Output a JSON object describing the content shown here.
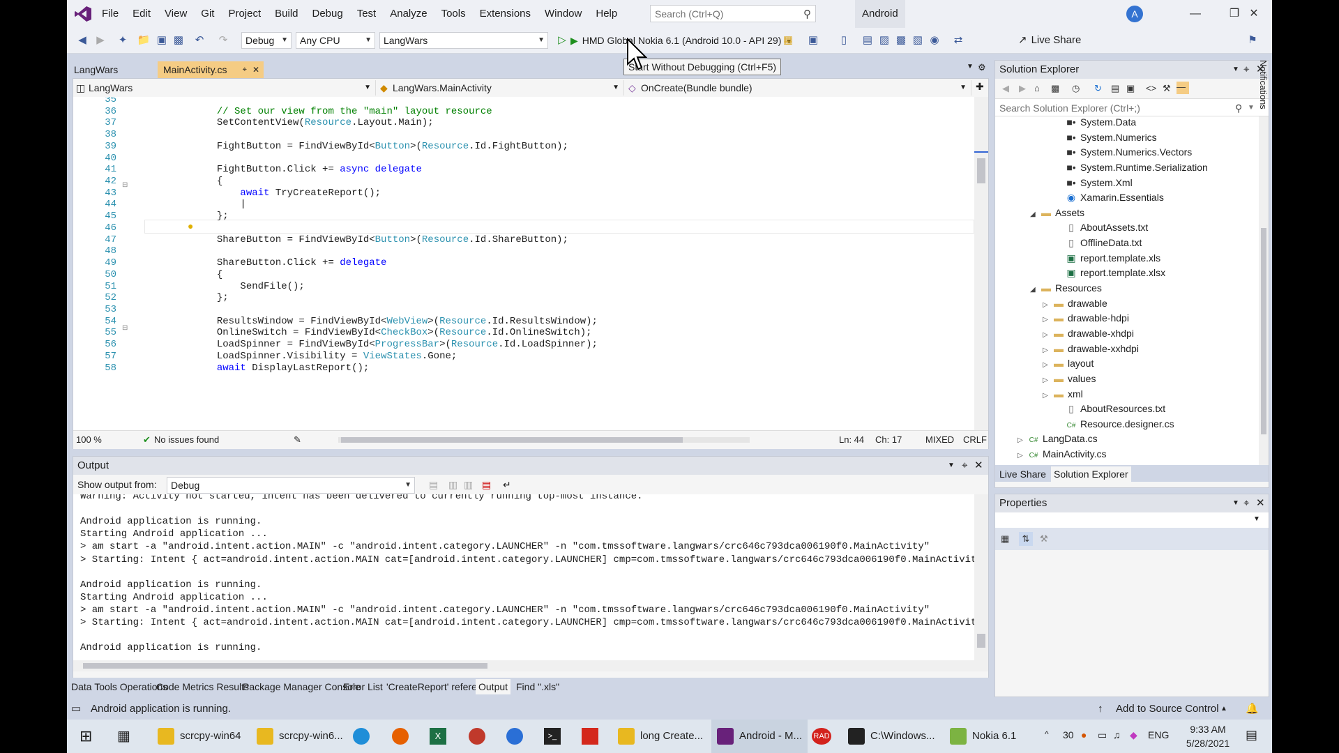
{
  "menu": [
    "File",
    "Edit",
    "View",
    "Git",
    "Project",
    "Build",
    "Debug",
    "Test",
    "Analyze",
    "Tools",
    "Extensions",
    "Window",
    "Help"
  ],
  "search": {
    "placeholder": "Search (Ctrl+Q)"
  },
  "solution_name": "Android",
  "user_initial": "A",
  "toolbar": {
    "config": "Debug",
    "platform": "Any CPU",
    "startup_project": "LangWars",
    "device": "HMD Global Nokia 6.1 (Android 10.0 - API 29)",
    "live_share": "Live Share"
  },
  "tooltip": "Start Without Debugging (Ctrl+F5)",
  "doc_tabs": [
    {
      "label": "LangWars"
    },
    {
      "label": "MainActivity.cs"
    }
  ],
  "nav": {
    "project": "LangWars",
    "type": "LangWars.MainActivity",
    "member": "OnCreate(Bundle bundle)"
  },
  "code_lines": [
    {
      "n": "35",
      "t": ""
    },
    {
      "n": "36",
      "t": "            // Set our view from the \"main\" layout resource"
    },
    {
      "n": "37",
      "t": "            SetContentView(Resource.Layout.Main);"
    },
    {
      "n": "38",
      "t": ""
    },
    {
      "n": "39",
      "t": "            FightButton = FindViewById<Button>(Resource.Id.FightButton);"
    },
    {
      "n": "40",
      "t": ""
    },
    {
      "n": "41",
      "t": "            FightButton.Click += async delegate"
    },
    {
      "n": "42",
      "t": "            {"
    },
    {
      "n": "43",
      "t": "                await TryCreateReport();"
    },
    {
      "n": "44",
      "t": "                |"
    },
    {
      "n": "45",
      "t": "            };"
    },
    {
      "n": "46",
      "t": ""
    },
    {
      "n": "47",
      "t": "            ShareButton = FindViewById<Button>(Resource.Id.ShareButton);"
    },
    {
      "n": "48",
      "t": ""
    },
    {
      "n": "49",
      "t": "            ShareButton.Click += delegate"
    },
    {
      "n": "50",
      "t": "            {"
    },
    {
      "n": "51",
      "t": "                SendFile();"
    },
    {
      "n": "52",
      "t": "            };"
    },
    {
      "n": "53",
      "t": ""
    },
    {
      "n": "54",
      "t": "            ResultsWindow = FindViewById<WebView>(Resource.Id.ResultsWindow);"
    },
    {
      "n": "55",
      "t": "            OnlineSwitch = FindViewById<CheckBox>(Resource.Id.OnlineSwitch);"
    },
    {
      "n": "56",
      "t": "            LoadSpinner = FindViewById<ProgressBar>(Resource.Id.LoadSpinner);"
    },
    {
      "n": "57",
      "t": "            LoadSpinner.Visibility = ViewStates.Gone;"
    },
    {
      "n": "58",
      "t": "            await DisplayLastReport();"
    }
  ],
  "editor_status": {
    "zoom": "100 %",
    "issues": "No issues found",
    "ln": "Ln: 44",
    "ch": "Ch: 17",
    "mode": "MIXED",
    "eol": "CRLF"
  },
  "output": {
    "title": "Output",
    "show_from_label": "Show output from:",
    "source": "Debug",
    "lines": [
      "Warning: Activity not started, intent has been delivered to currently running top-most instance.",
      "",
      "Android application is running.",
      "Starting Android application ...",
      "> am start -a \"android.intent.action.MAIN\" -c \"android.intent.category.LAUNCHER\" -n \"com.tmssoftware.langwars/crc646c793dca006190f0.MainActivity\"",
      "> Starting: Intent { act=android.intent.action.MAIN cat=[android.intent.category.LAUNCHER] cmp=com.tmssoftware.langwars/crc646c793dca006190f0.MainActivity }",
      "",
      "Android application is running.",
      "Starting Android application ...",
      "> am start -a \"android.intent.action.MAIN\" -c \"android.intent.category.LAUNCHER\" -n \"com.tmssoftware.langwars/crc646c793dca006190f0.MainActivity\"",
      "> Starting: Intent { act=android.intent.action.MAIN cat=[android.intent.category.LAUNCHER] cmp=com.tmssoftware.langwars/crc646c793dca006190f0.MainActivity }",
      "",
      "Android application is running."
    ]
  },
  "bottom_tabs": [
    "Data Tools Operations",
    "Code Metrics Results",
    "Package Manager Console",
    "Error List",
    "'CreateReport' references",
    "Output",
    "Find \".xls\""
  ],
  "solution_explorer": {
    "title": "Solution Explorer",
    "search_placeholder": "Search Solution Explorer (Ctrl+;)",
    "items": [
      {
        "label": "System.Data",
        "icon": "reference-icon"
      },
      {
        "label": "System.Numerics",
        "icon": "reference-icon"
      },
      {
        "label": "System.Numerics.Vectors",
        "icon": "reference-icon"
      },
      {
        "label": "System.Runtime.Serialization",
        "icon": "reference-icon"
      },
      {
        "label": "System.Xml",
        "icon": "reference-icon"
      },
      {
        "label": "Xamarin.Essentials",
        "icon": "package-icon"
      },
      {
        "label": "Assets",
        "icon": "folder-icon"
      },
      {
        "label": "AboutAssets.txt",
        "icon": "file-icon"
      },
      {
        "label": "OfflineData.txt",
        "icon": "file-icon"
      },
      {
        "label": "report.template.xls",
        "icon": "excel-icon"
      },
      {
        "label": "report.template.xlsx",
        "icon": "excel-icon"
      },
      {
        "label": "Resources",
        "icon": "folder-icon"
      },
      {
        "label": "drawable",
        "icon": "folder-icon"
      },
      {
        "label": "drawable-hdpi",
        "icon": "folder-icon"
      },
      {
        "label": "drawable-xhdpi",
        "icon": "folder-icon"
      },
      {
        "label": "drawable-xxhdpi",
        "icon": "folder-icon"
      },
      {
        "label": "layout",
        "icon": "folder-icon"
      },
      {
        "label": "values",
        "icon": "folder-icon"
      },
      {
        "label": "xml",
        "icon": "folder-icon"
      },
      {
        "label": "AboutResources.txt",
        "icon": "file-icon"
      },
      {
        "label": "Resource.designer.cs",
        "icon": "csharp-icon"
      },
      {
        "label": "LangData.cs",
        "icon": "csharp-icon"
      },
      {
        "label": "MainActivity.cs",
        "icon": "csharp-icon"
      }
    ],
    "tabs": [
      "Live Share",
      "Solution Explorer"
    ]
  },
  "properties": {
    "title": "Properties"
  },
  "notifications_label": "Notifications",
  "statusbar": {
    "message": "Android application is running.",
    "source_control": "Add to Source Control"
  },
  "taskbar": {
    "apps": [
      "scrcpy-win64",
      "scrcpy-win6...",
      "long Create...",
      "Android - M...",
      "C:\\Windows...",
      "Nokia 6.1"
    ],
    "temp": "30",
    "lang": "ENG",
    "time": "9:33 AM",
    "date": "5/28/2021"
  },
  "colors": {
    "accent": "#68217a",
    "keyword": "#0000ff",
    "type": "#2b91af",
    "comment": "#008000",
    "string": "#a31515",
    "play": "#1e8f1e"
  }
}
